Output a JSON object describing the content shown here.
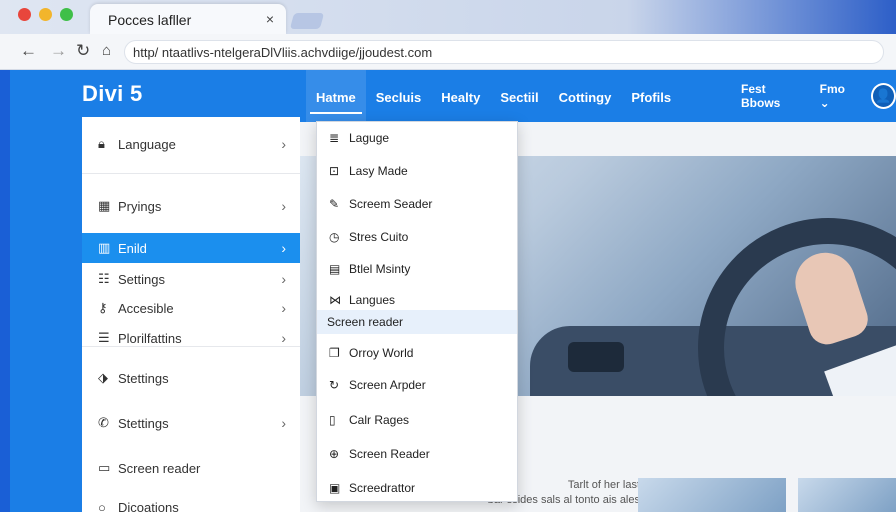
{
  "browser": {
    "tab_title": "Pocces lafller",
    "tab_close": "×",
    "nav": {
      "back": "←",
      "forward": "→",
      "reload": "↻",
      "home": "⌂"
    },
    "url": "http/ ntaatlivs-ntelgeraDlVliis.achvdiige/jjoudest.com",
    "window_dot_colors": [
      "#e8463c",
      "#f2b52c",
      "#3fbf48"
    ]
  },
  "header": {
    "logo": "Divi 5",
    "nav": [
      {
        "label": "Hatme",
        "active": true
      },
      {
        "label": "Secluis"
      },
      {
        "label": "Healty"
      },
      {
        "label": "Sectiil"
      },
      {
        "label": "Cottingy"
      },
      {
        "label": "Pfofils"
      }
    ],
    "right_link": "Fest Bbows",
    "right_menu": "Fmo",
    "right_caret": "⌄",
    "avatar_glyph": "👤",
    "accent_color": "#1b7ee6"
  },
  "sidebar": {
    "chevron": "›",
    "items": [
      {
        "label": "Language",
        "icon": "lock-icon",
        "glyph": "🔒︎",
        "chevron": true
      },
      {
        "label": "Pryings",
        "icon": "calendar-icon",
        "glyph": "▦",
        "chevron": true
      },
      {
        "label": "Enild",
        "icon": "columns-icon",
        "glyph": "▥",
        "chevron": true,
        "active": true
      },
      {
        "label": "Settings",
        "icon": "table-icon",
        "glyph": "☷",
        "chevron": true
      },
      {
        "label": "Accesible",
        "icon": "key-icon",
        "glyph": "⚷",
        "chevron": true
      },
      {
        "label": "Plorilfattins",
        "icon": "database-icon",
        "glyph": "☰",
        "chevron": true
      },
      {
        "label": "Stettings",
        "icon": "tag-icon",
        "glyph": "⬗",
        "chevron": false
      },
      {
        "label": "Stettings",
        "icon": "phone-icon",
        "glyph": "✆",
        "chevron": true
      },
      {
        "label": "Screen reader",
        "icon": "monitor-icon",
        "glyph": "▭",
        "chevron": false
      },
      {
        "label": "Dicoations",
        "icon": "circle-icon",
        "glyph": "○",
        "chevron": false
      }
    ]
  },
  "dropdown": {
    "items": [
      {
        "label": "Laguge",
        "icon": "list-icon",
        "glyph": "≣"
      },
      {
        "label": "Lasy Made",
        "icon": "image-icon",
        "glyph": "⊡"
      },
      {
        "label": "Screem Seader",
        "icon": "edit-icon",
        "glyph": "✎"
      },
      {
        "label": "Stres Cuito",
        "icon": "clock-icon",
        "glyph": "◷"
      },
      {
        "label": "Btlel Msinty",
        "icon": "card-icon",
        "glyph": "▤"
      },
      {
        "label": "Langues",
        "icon": "link-icon",
        "glyph": "⋈"
      },
      {
        "label": "Screen reader",
        "icon": "",
        "glyph": "",
        "highlight": true
      },
      {
        "label": "Orroy World",
        "icon": "copy-icon",
        "glyph": "❐"
      },
      {
        "label": "Screen Arpder",
        "icon": "refresh-icon",
        "glyph": "↻"
      },
      {
        "label": "Calr Rages",
        "icon": "pages-icon",
        "glyph": "▯"
      },
      {
        "label": "Screen Reader",
        "icon": "globe-icon",
        "glyph": "⊕"
      },
      {
        "label": "Screedrattor",
        "icon": "document-icon",
        "glyph": "▣"
      }
    ]
  },
  "content": {
    "caption_lines": [
      "Tarlt of her last",
      "bar ssides sals al tonto ais ales"
    ]
  }
}
